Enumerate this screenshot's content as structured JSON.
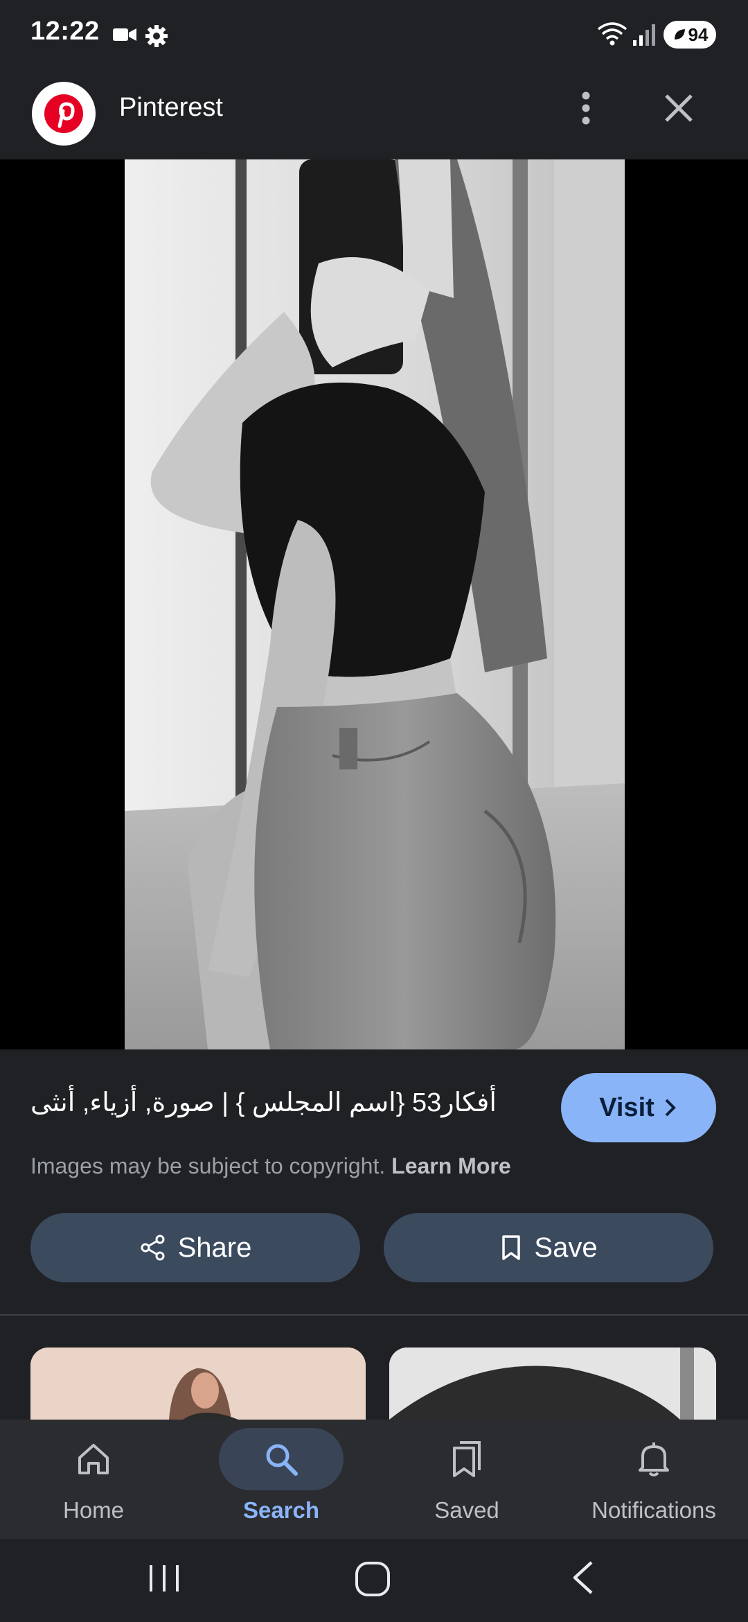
{
  "status_bar": {
    "time": "12:22",
    "battery": "94",
    "icons": [
      "video-icon",
      "settings-icon",
      "wifi-icon",
      "signal-icon",
      "battery-icon"
    ]
  },
  "header": {
    "source_name": "Pinterest",
    "logo_icon": "pinterest-logo",
    "menu_icon": "more-vert-icon",
    "close_icon": "close-icon"
  },
  "image": {
    "lens_icon": "lens-icon"
  },
  "result": {
    "title": "أفكار53 {اسم المجلس } | صورة, أزياء, أنثى",
    "visit_label": "Visit",
    "copyright_text": "Images may be subject to copyright.",
    "learn_more": "Learn More",
    "share_label": "Share",
    "save_label": "Save"
  },
  "bottom_nav": {
    "items": [
      {
        "label": "Home",
        "icon": "home-icon",
        "active": false
      },
      {
        "label": "Search",
        "icon": "search-icon",
        "active": true
      },
      {
        "label": "Saved",
        "icon": "saved-icon",
        "active": false
      },
      {
        "label": "Notifications",
        "icon": "bell-icon",
        "active": false
      }
    ]
  },
  "colors": {
    "background": "#202124",
    "accent": "#8ab4f8",
    "pill": "#3c4a5e",
    "brand_red": "#e60023"
  }
}
